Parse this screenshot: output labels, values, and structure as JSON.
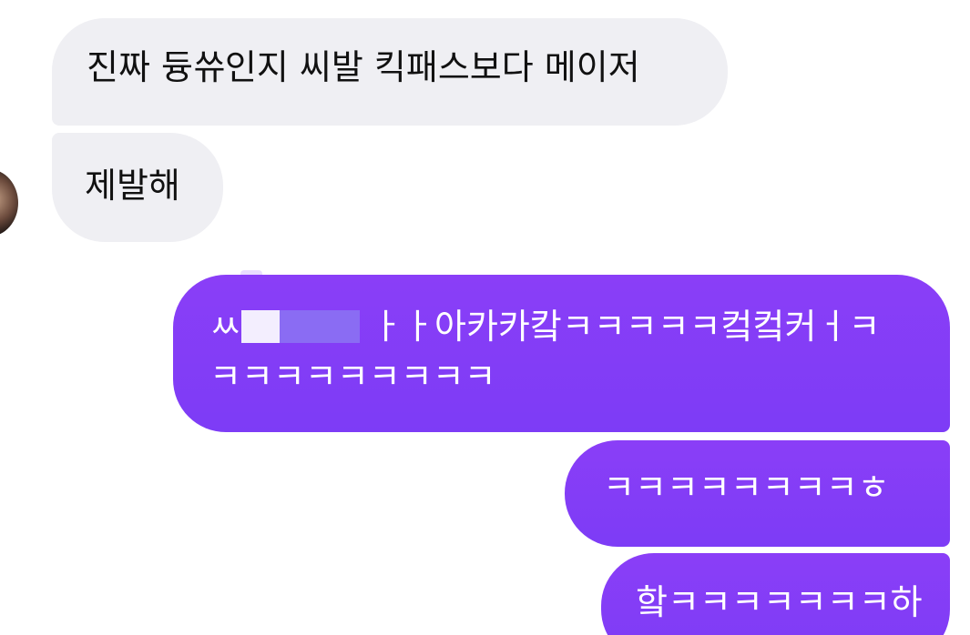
{
  "conversation": {
    "incoming": [
      {
        "text": "진짜 듕쓔인지 씨발 킥패스보다 메이저"
      },
      {
        "text": "제발해"
      }
    ],
    "outgoing": [
      {
        "text_start": "ㅆ",
        "text_end": "ㅏㅏ아카카캌ㅋㅋㅋㅋㅋ컼컼커ㅓㅋ ㅋㅋㅋㅋㅋㅋㅋㅋㅋ"
      },
      {
        "text": "ㅋㅋㅋㅋㅋㅋㅋㅋㅎ"
      },
      {
        "text": "핰ㅋㅋㅋㅋㅋㅋㅋ하"
      }
    ]
  },
  "colors": {
    "incoming_bubble": "#efeff3",
    "outgoing_bubble": "#7d3cf6",
    "background": "#ffffff"
  }
}
